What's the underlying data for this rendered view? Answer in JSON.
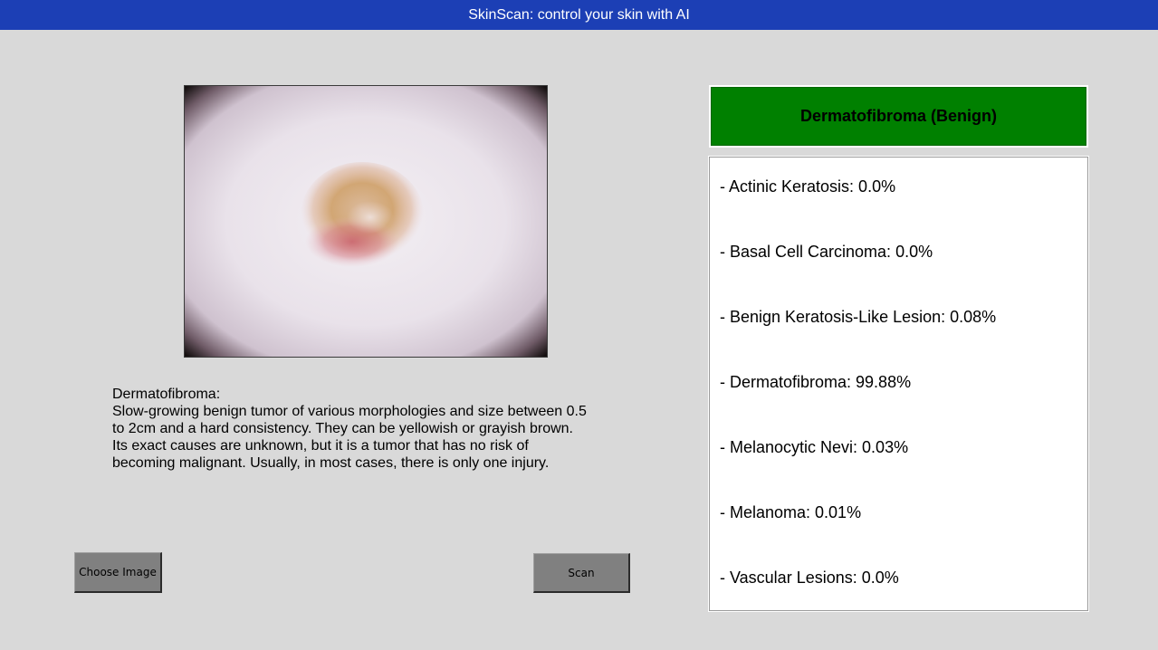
{
  "window": {
    "title": "SkinScan: control your skin with AI"
  },
  "image": {
    "description": "dermoscopy-image-icon"
  },
  "description": {
    "heading": "Dermatofibroma:",
    "lines": [
      "Slow-growing benign tumor of various morphologies and size between 0.5",
      "to 2cm and a hard consistency. They can be yellowish or grayish brown.",
      "Its exact causes are unknown, but it is a tumor that has no risk of",
      "becoming malignant. Usually, in most cases, there is only one injury."
    ]
  },
  "buttons": {
    "choose_image": "Choose Image",
    "scan": "Scan"
  },
  "result": {
    "label": "Dermatofibroma (Benign)",
    "color": "#008000"
  },
  "probabilities": [
    "- Actinic Keratosis: 0.0%",
    "- Basal Cell Carcinoma: 0.0%",
    "- Benign Keratosis-Like Lesion: 0.08%",
    "- Dermatofibroma: 99.88%",
    "- Melanocytic Nevi: 0.03%",
    "- Melanoma: 0.01%",
    "- Vascular Lesions: 0.0%"
  ],
  "colors": {
    "title_bar": "#1c3fb5",
    "background": "#d9d9d9",
    "button": "#808080"
  }
}
